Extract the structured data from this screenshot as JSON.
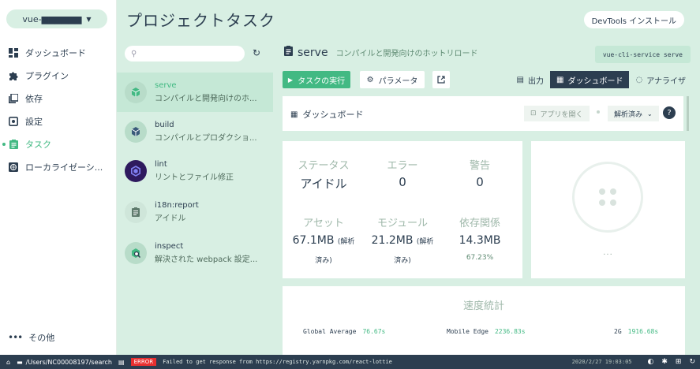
{
  "project": {
    "name": "vue-▆▆▆▆▆▆"
  },
  "nav": {
    "items": [
      {
        "label": "ダッシュボード",
        "icon": "dashboard-icon"
      },
      {
        "label": "プラグイン",
        "icon": "puzzle-icon"
      },
      {
        "label": "依存",
        "icon": "library-icon"
      },
      {
        "label": "設定",
        "icon": "settings-icon"
      },
      {
        "label": "タスク",
        "icon": "assignment-icon",
        "active": true
      },
      {
        "label": "ローカライゼーシ...",
        "icon": "language-icon"
      }
    ],
    "more": "その他"
  },
  "header": {
    "title": "プロジェクトタスク",
    "devtools": "DevTools インストール"
  },
  "tasks": {
    "search_placeholder": "",
    "list": [
      {
        "name": "serve",
        "desc": "コンパイルと開発向けのホ...",
        "selected": true
      },
      {
        "name": "build",
        "desc": "コンパイルとプロダクショ..."
      },
      {
        "name": "lint",
        "desc": "リントとファイル修正"
      },
      {
        "name": "i18n:report",
        "desc": "アイドル"
      },
      {
        "name": "inspect",
        "desc": "解決された webpack 設定..."
      }
    ]
  },
  "main": {
    "task_name": "serve",
    "task_desc": "コンパイルと開発向けのホットリロード",
    "command": "vue-cli-service serve",
    "run_label": "タスクの実行",
    "params_label": "パラメータ",
    "tabs": {
      "output": "出力",
      "dashboard": "ダッシュボード",
      "analyzer": "アナライザ"
    },
    "dashboard_label": "ダッシュボード",
    "open_app": "アプリを開く",
    "analyzed": "解析済み",
    "help": "?",
    "stats": {
      "status_label": "ステータス",
      "status_value": "アイドル",
      "errors_label": "エラー",
      "errors_value": "0",
      "warnings_label": "警告",
      "warnings_value": "0",
      "assets_label": "アセット",
      "assets_value": "67.1MB",
      "assets_note1": "(解析",
      "assets_note2": "済み)",
      "modules_label": "モジュール",
      "modules_value": "21.2MB",
      "modules_note1": "(解析",
      "modules_note2": "済み)",
      "deps_label": "依存関係",
      "deps_value": "14.3MB",
      "deps_pct": "67.23%"
    },
    "progress_dots": "...",
    "speed": {
      "title": "速度統計",
      "items": [
        {
          "label": "Global Average",
          "value": "76.67s"
        },
        {
          "label": "Mobile Edge",
          "value": "2236.83s"
        },
        {
          "label": "2G",
          "value": "1916.68s"
        }
      ]
    }
  },
  "statusbar": {
    "path": "/Users/NC00008197/search",
    "error_badge": "ERROR",
    "log": "Failed to get response from https://registry.yarnpkg.com/react-lottie",
    "time": "2020/2/27 19:03:05"
  }
}
